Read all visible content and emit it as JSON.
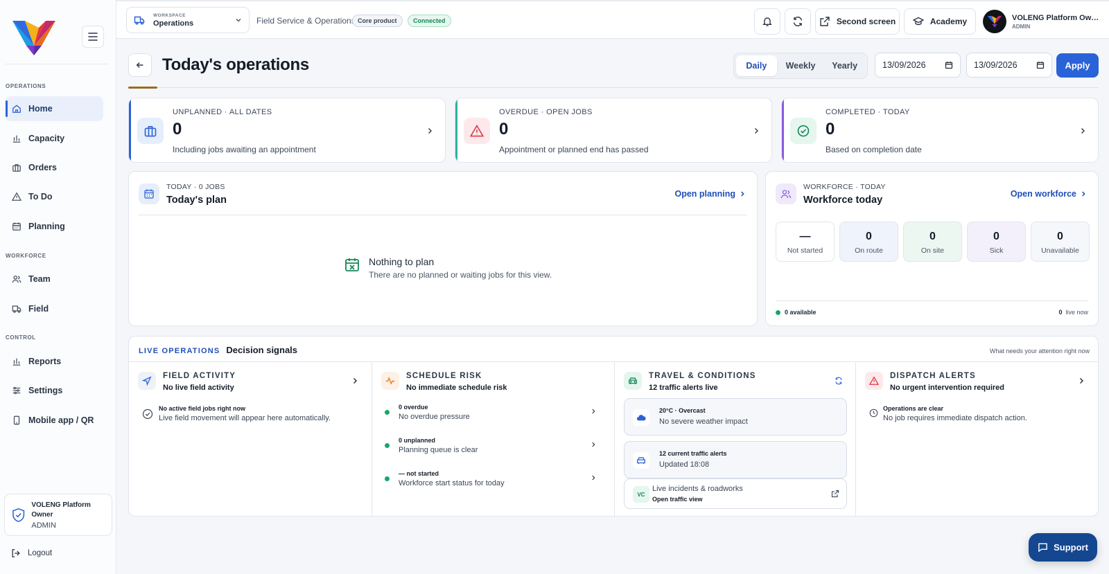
{
  "sidebar": {
    "sections": [
      "OPERATIONS",
      "WORKFORCE",
      "CONTROL"
    ],
    "items": [
      {
        "label": "Home",
        "icon": "home-icon"
      },
      {
        "label": "Capacity",
        "icon": "bar-chart-icon"
      },
      {
        "label": "Orders",
        "icon": "briefcase-icon"
      },
      {
        "label": "To Do",
        "icon": "alert-triangle-icon"
      },
      {
        "label": "Planning",
        "icon": "calendar-icon"
      },
      {
        "label": "Team",
        "icon": "users-icon"
      },
      {
        "label": "Field",
        "icon": "truck-icon"
      },
      {
        "label": "Reports",
        "icon": "bar-chart-icon"
      },
      {
        "label": "Settings",
        "icon": "sliders-icon"
      },
      {
        "label": "Mobile app / QR",
        "icon": "smartphone-icon"
      }
    ],
    "user": {
      "name": "VOLENG Platform Owner",
      "role": "ADMIN"
    },
    "logout_label": "Logout"
  },
  "topbar": {
    "workspace_label": "WORKSPACE",
    "workspace_value": "Operations",
    "breadcrumb": "Field Service & Operations",
    "badge_core": "Core product",
    "badge_connected": "Connected",
    "second_screen": "Second screen",
    "academy": "Academy",
    "account_name": "VOLENG Platform Owner",
    "account_role": "ADMIN"
  },
  "header": {
    "title": "Today's operations",
    "periods": [
      "Daily",
      "Weekly",
      "Yearly"
    ],
    "active_period": "Daily",
    "date_from": "13/09/2026",
    "date_to": "13/09/2026",
    "apply": "Apply"
  },
  "kpis": [
    {
      "label": "UNPLANNED · ALL DATES",
      "value": "0",
      "sub": "Including jobs awaiting an appointment",
      "accent": "#2c63d6"
    },
    {
      "label": "OVERDUE · OPEN JOBS",
      "value": "0",
      "sub": "Appointment or planned end has passed",
      "accent": "#2ab3a0"
    },
    {
      "label": "COMPLETED · TODAY",
      "value": "0",
      "sub": "Based on completion date",
      "accent": "#8a5ce0"
    }
  ],
  "plan": {
    "label": "TODAY · 0 JOBS",
    "title": "Today's plan",
    "link": "Open planning",
    "empty_title": "Nothing to plan",
    "empty_sub": "There are no planned or waiting jobs for this view."
  },
  "workforce": {
    "label": "WORKFORCE · TODAY",
    "title": "Workforce today",
    "link": "Open workforce",
    "stats": [
      {
        "value": "—",
        "label": "Not started"
      },
      {
        "value": "0",
        "label": "On route"
      },
      {
        "value": "0",
        "label": "On site"
      },
      {
        "value": "0",
        "label": "Sick"
      },
      {
        "value": "0",
        "label": "Unavailable"
      }
    ],
    "available": "0 available",
    "live_count": "0",
    "live_label": "live now"
  },
  "live": {
    "tag": "LIVE OPERATIONS",
    "title": "Decision signals",
    "right": "What needs your attention right now",
    "field": {
      "name": "FIELD ACTIVITY",
      "summary": "No live field activity",
      "row_title": "No active field jobs right now",
      "row_text": "Live field movement will appear here automatically."
    },
    "schedule": {
      "name": "SCHEDULE RISK",
      "summary": "No immediate schedule risk",
      "rows": [
        {
          "k": "0 overdue",
          "v": "No overdue pressure"
        },
        {
          "k": "0 unplanned",
          "v": "Planning queue is clear"
        },
        {
          "k": "— not started",
          "v": "Workforce start status for today"
        }
      ]
    },
    "travel": {
      "name": "TRAVEL & CONDITIONS",
      "summary": "12 traffic alerts live",
      "weather_title": "20°C · Overcast",
      "weather_text": "No severe weather impact",
      "traffic_title": "12 current traffic alerts",
      "traffic_text": "Updated 18:08",
      "incidents_badge": "VC",
      "incidents_title": "Live incidents & roadworks",
      "incidents_link": "Open traffic view"
    },
    "dispatch": {
      "name": "DISPATCH ALERTS",
      "summary": "No urgent intervention required",
      "row_title": "Operations are clear",
      "row_text": "No job requires immediate dispatch action."
    }
  },
  "support_label": "Support"
}
